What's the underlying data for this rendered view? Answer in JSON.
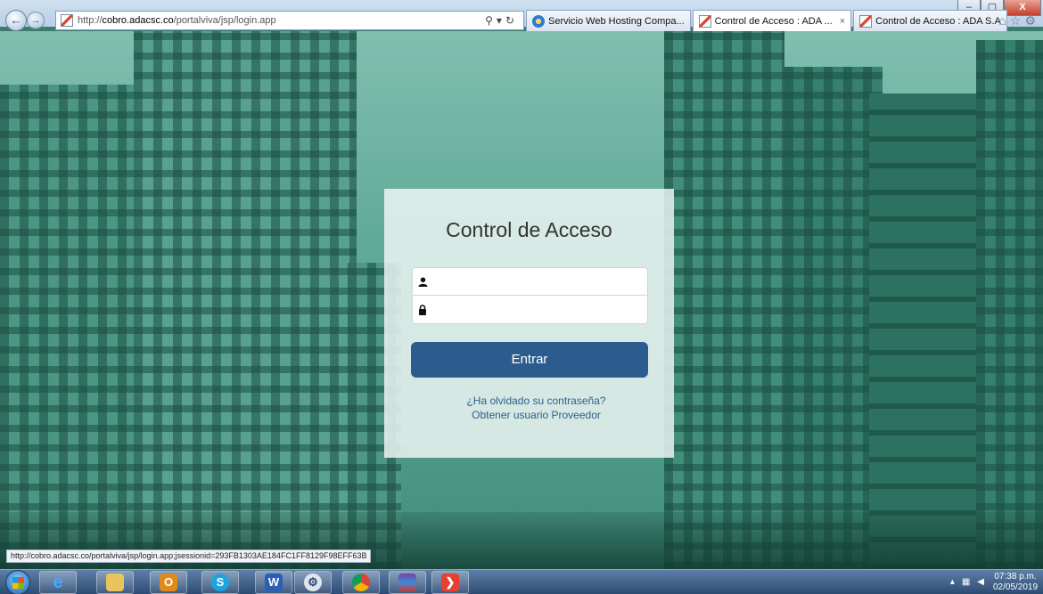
{
  "browser": {
    "address": "http://cobro.adacsc.co/portalviva/jsp/login.app",
    "address_host": "cobro.adacsc.co",
    "address_prefix": "http://",
    "address_path": "/portalviva/jsp/login.app",
    "tabs": [
      {
        "label": "Servicio Web Hosting Compa...",
        "icon": "ie-icon"
      },
      {
        "label": "Control de Acceso : ADA ...",
        "icon": "site-icon",
        "active": true
      },
      {
        "label": "Control de Acceso : ADA S.A",
        "icon": "site-icon"
      }
    ],
    "window_controls": {
      "minimize": "–",
      "maximize": "▢",
      "close": "X"
    },
    "status_text": "http://cobro.adacsc.co/portalviva/jsp/login.app;jsessionid=293FB1303AE184FC1FF8129F98EFF63B"
  },
  "login": {
    "title": "Control de Acceso",
    "username_value": "",
    "password_value": "",
    "submit_label": "Entrar",
    "forgot_link": "¿Ha olvidado su contraseña?",
    "provider_link": "Obtener usuario Proveedor",
    "button_color": "#2c5c8e"
  },
  "taskbar": {
    "apps": [
      "start-orb",
      "internet-explorer-icon",
      "file-explorer-icon",
      "outlook-icon",
      "skype-icon",
      "word-icon",
      "settings-icon",
      "chrome-icon",
      "winrar-icon",
      "anydesk-icon"
    ],
    "time": "07:38 p.m.",
    "date": "02/05/2019"
  }
}
